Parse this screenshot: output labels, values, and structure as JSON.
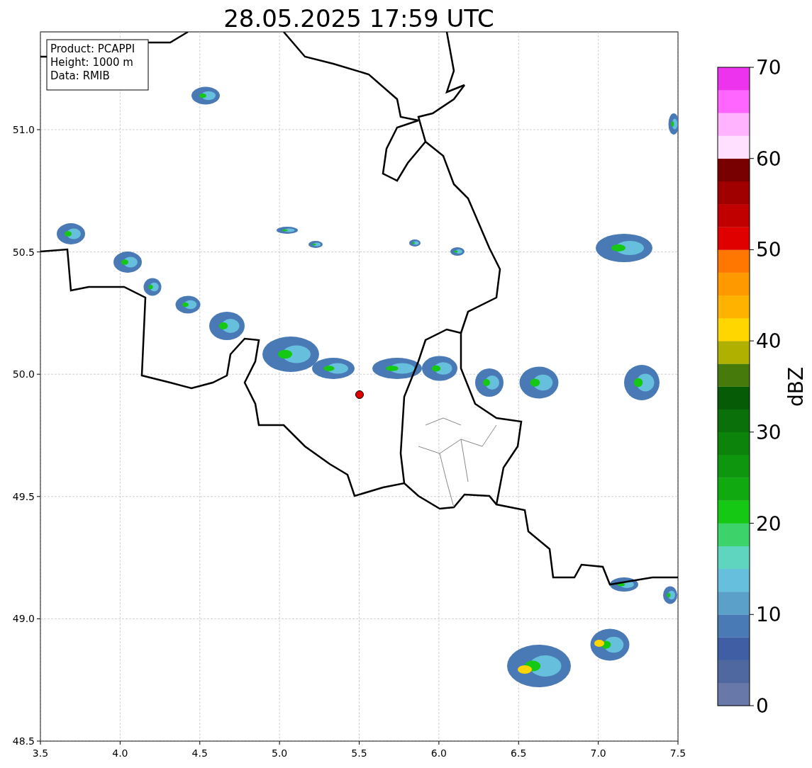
{
  "title": "28.05.2025 17:59 UTC",
  "info_box": [
    "Product: PCAPPI",
    "Height: 1000 m",
    "Data: RMIB"
  ],
  "map": {
    "xticks": [
      "3.5",
      "4.0",
      "4.5",
      "5.0",
      "5.5",
      "6.0",
      "6.5",
      "7.0",
      "7.5"
    ],
    "yticks": [
      "51.0",
      "50.5",
      "50.0",
      "49.5",
      "49.0",
      "48.5"
    ]
  },
  "colorbar": {
    "label": "dBZ",
    "ticks": [
      "70",
      "60",
      "50",
      "40",
      "30",
      "20",
      "10",
      "0"
    ],
    "bands": [
      {
        "color": "#6878a8"
      },
      {
        "color": "#5068a0"
      },
      {
        "color": "#405ea4"
      },
      {
        "color": "#4a7ab5"
      },
      {
        "color": "#5aa0c8"
      },
      {
        "color": "#66c0dd"
      },
      {
        "color": "#5fd5c0"
      },
      {
        "color": "#3cd46a"
      },
      {
        "color": "#14c814"
      },
      {
        "color": "#10aa10"
      },
      {
        "color": "#0e960e"
      },
      {
        "color": "#0c840c"
      },
      {
        "color": "#0a700a"
      },
      {
        "color": "#065c06"
      },
      {
        "color": "#467a0a"
      },
      {
        "color": "#b0b000"
      },
      {
        "color": "#ffd600"
      },
      {
        "color": "#ffb300"
      },
      {
        "color": "#ff9900"
      },
      {
        "color": "#ff7700"
      },
      {
        "color": "#e00000"
      },
      {
        "color": "#c00000"
      },
      {
        "color": "#a00000"
      },
      {
        "color": "#780000"
      },
      {
        "color": "#ffe0ff"
      },
      {
        "color": "#ffb3ff"
      },
      {
        "color": "#ff66ff"
      },
      {
        "color": "#ee33ee"
      }
    ]
  }
}
